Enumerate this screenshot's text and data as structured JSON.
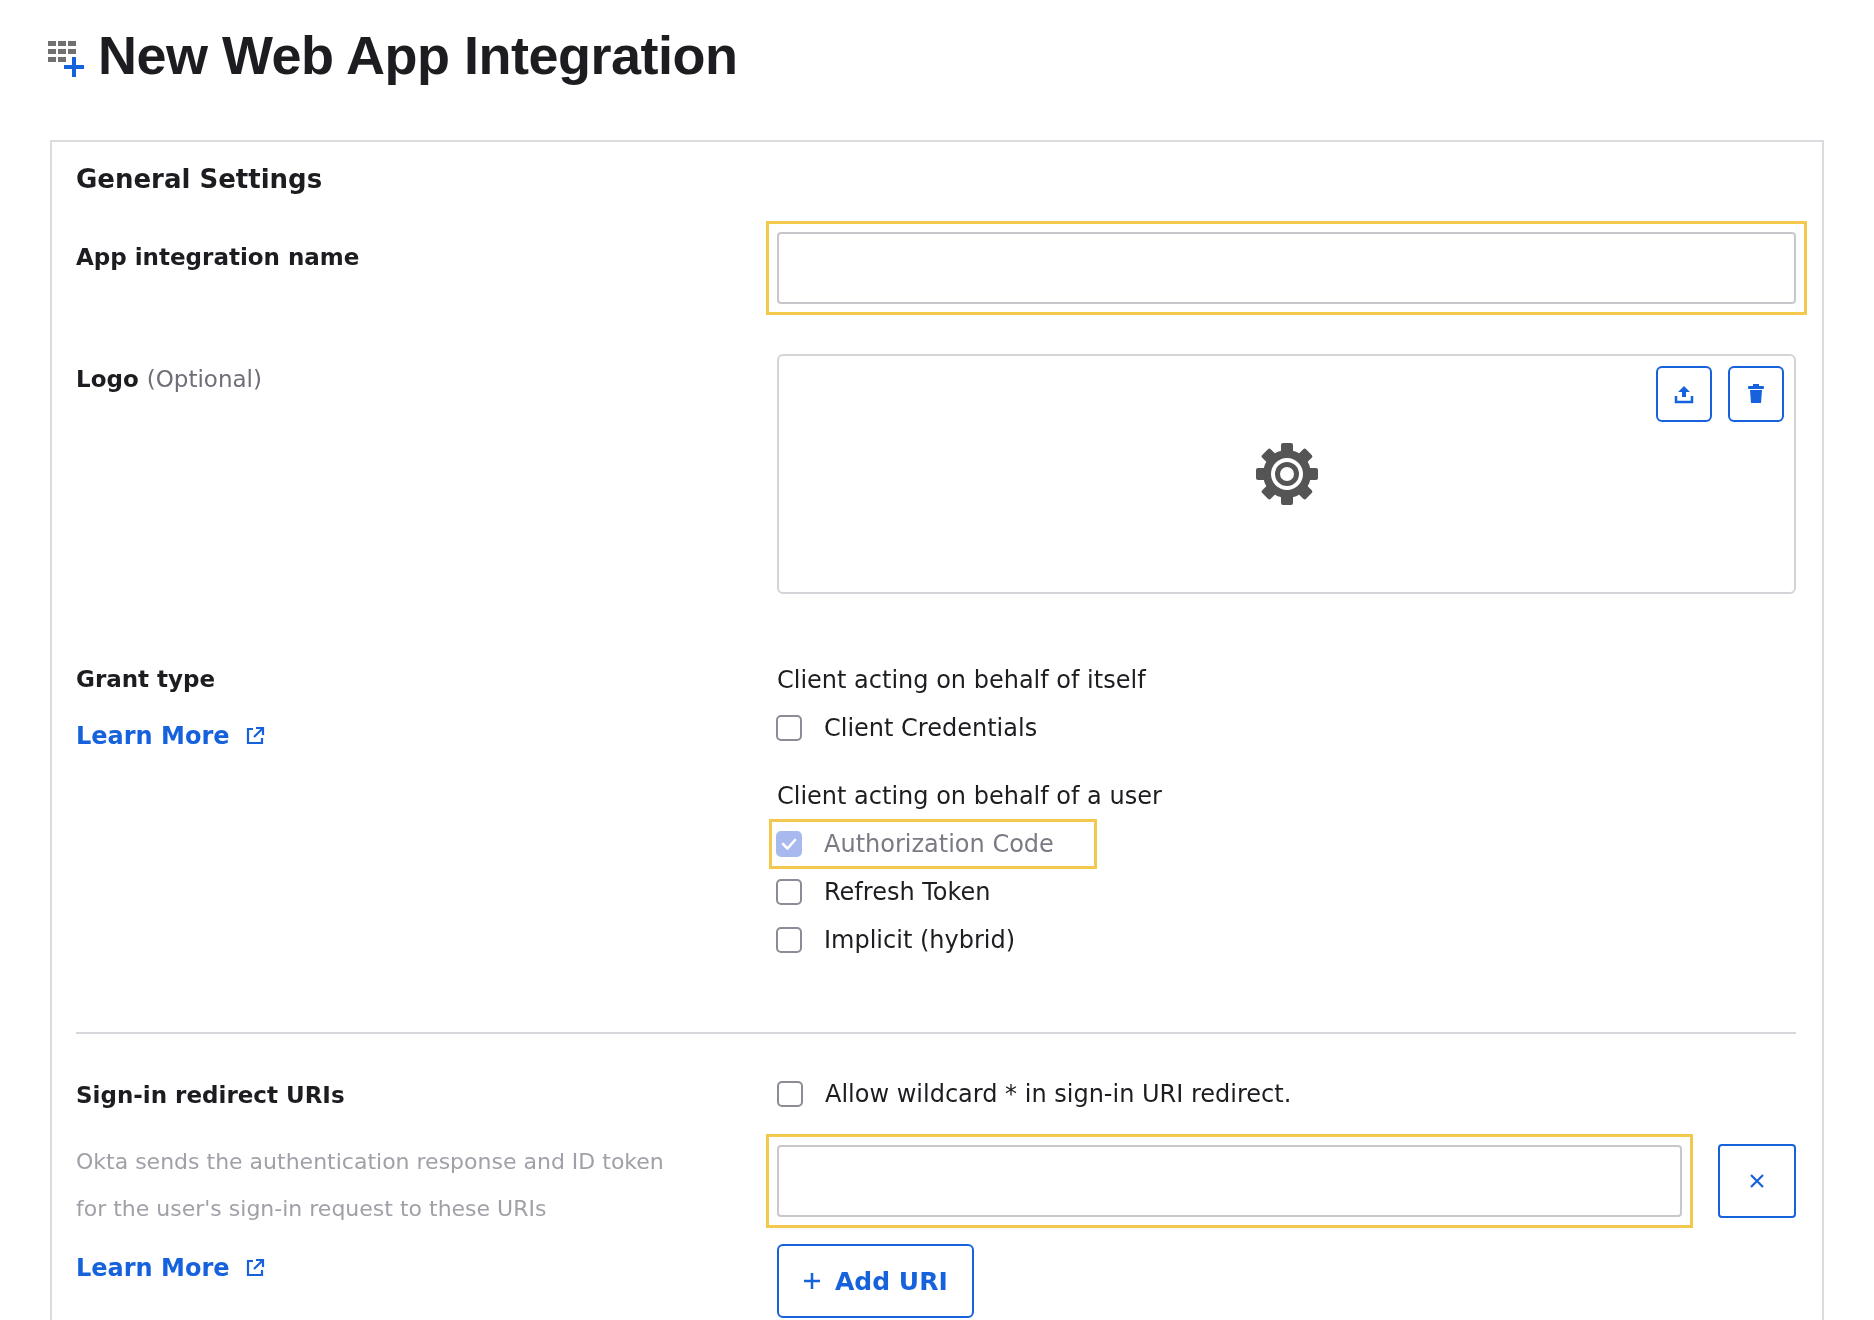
{
  "page": {
    "title": "New Web App Integration"
  },
  "section": {
    "title": "General Settings"
  },
  "app_name": {
    "label": "App integration name",
    "highlighted": true
  },
  "logo": {
    "label": "Logo",
    "hint": "(Optional)"
  },
  "grant_type": {
    "label": "Grant type",
    "learn_more": "Learn More",
    "groups": [
      {
        "heading": "Client acting on behalf of itself",
        "options": [
          {
            "label": "Client Credentials",
            "checked": false,
            "disabled": false,
            "highlighted": false
          }
        ]
      },
      {
        "heading": "Client acting on behalf of a user",
        "options": [
          {
            "label": "Authorization Code",
            "checked": true,
            "disabled": true,
            "highlighted": true
          },
          {
            "label": "Refresh Token",
            "checked": false,
            "disabled": false,
            "highlighted": false
          },
          {
            "label": "Implicit (hybrid)",
            "checked": false,
            "disabled": false,
            "highlighted": false
          }
        ]
      }
    ]
  },
  "redirect": {
    "label": "Sign-in redirect URIs",
    "description": "Okta sends the authentication response and ID token for the user's sign-in request to these URIs",
    "learn_more": "Learn More",
    "wildcard": {
      "label": "Allow wildcard * in sign-in URI redirect.",
      "checked": false
    },
    "uris": [
      {
        "highlighted": true
      }
    ],
    "add_button": "Add URI"
  }
}
